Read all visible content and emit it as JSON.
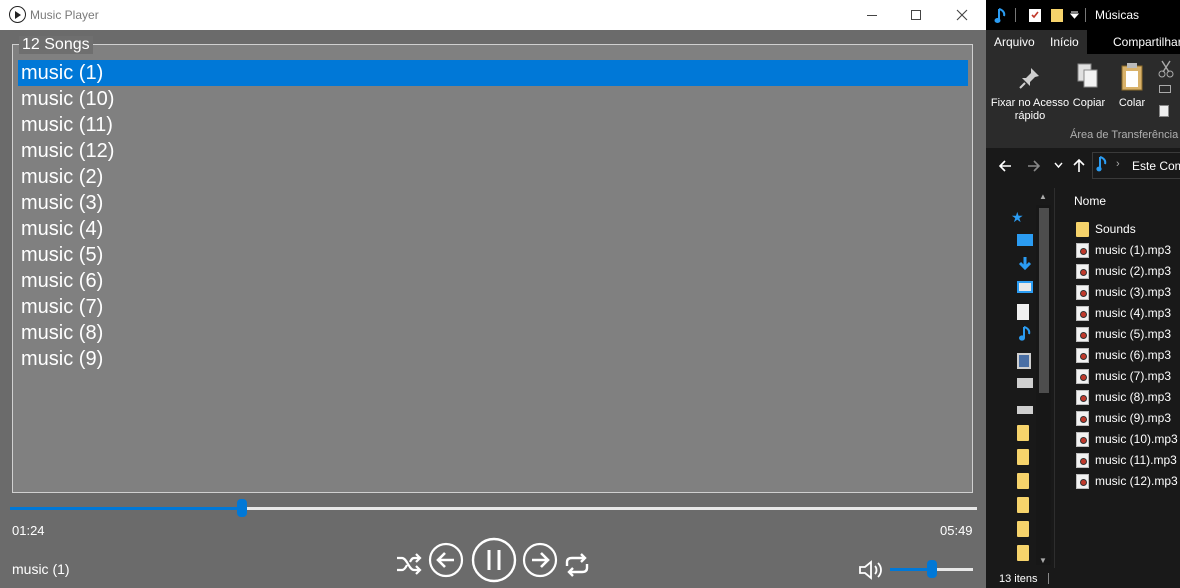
{
  "player": {
    "title": "Music Player",
    "group_label": "12 Songs",
    "songs": [
      "music (1)",
      "music (10)",
      "music (11)",
      "music (12)",
      "music (2)",
      "music (3)",
      "music (4)",
      "music (5)",
      "music (6)",
      "music (7)",
      "music (8)",
      "music (9)"
    ],
    "selected_index": 0,
    "time_current": "01:24",
    "time_total": "05:49",
    "progress": 0.24,
    "now_playing": "music (1)",
    "volume": 0.5,
    "controls": [
      "shuffle-icon",
      "previous-icon",
      "pause-icon",
      "next-icon",
      "repeat-icon",
      "volume-icon"
    ],
    "accent": "#0078d7"
  },
  "explorer": {
    "title": "Músicas",
    "tabs": [
      "Arquivo",
      "Início",
      "Compartilhar"
    ],
    "ribbon": {
      "pin_label": "Fixar no Acesso rápido",
      "copy_label": "Copiar",
      "paste_label": "Colar",
      "group_label": "Área de Transferência"
    },
    "address": "Este Com",
    "column_header": "Nome",
    "files": [
      {
        "name": "Sounds",
        "type": "folder"
      },
      {
        "name": "music (1).mp3",
        "type": "mp3"
      },
      {
        "name": "music (2).mp3",
        "type": "mp3"
      },
      {
        "name": "music (3).mp3",
        "type": "mp3"
      },
      {
        "name": "music (4).mp3",
        "type": "mp3"
      },
      {
        "name": "music (5).mp3",
        "type": "mp3"
      },
      {
        "name": "music (6).mp3",
        "type": "mp3"
      },
      {
        "name": "music (7).mp3",
        "type": "mp3"
      },
      {
        "name": "music (8).mp3",
        "type": "mp3"
      },
      {
        "name": "music (9).mp3",
        "type": "mp3"
      },
      {
        "name": "music (10).mp3",
        "type": "mp3"
      },
      {
        "name": "music (11).mp3",
        "type": "mp3"
      },
      {
        "name": "music (12).mp3",
        "type": "mp3"
      }
    ],
    "status": "13 itens"
  }
}
